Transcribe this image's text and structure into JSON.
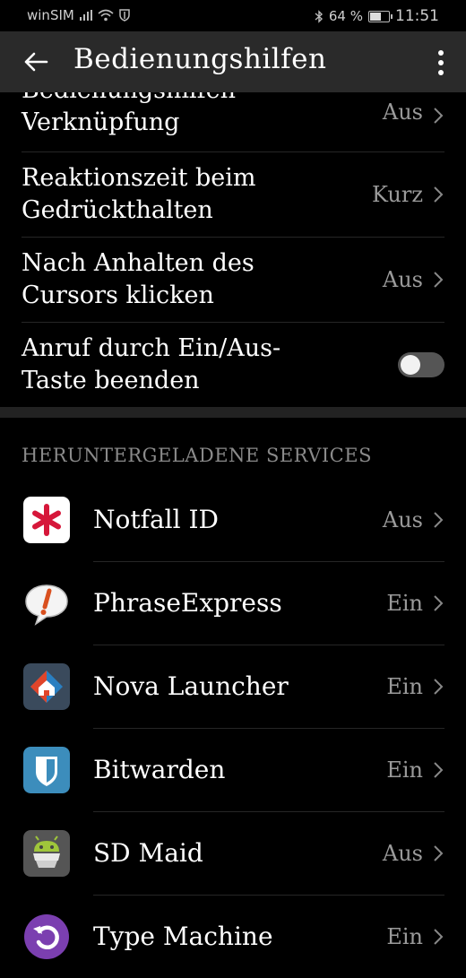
{
  "status_bar": {
    "carrier": "winSIM",
    "battery_percent": "64 %",
    "battery_level": 0.64,
    "time": "11:51"
  },
  "app_bar": {
    "title": "Bedienungshilfen"
  },
  "settings": [
    {
      "label": "Bedienungshilfen-\nVerknüpfung",
      "value": "Aus"
    },
    {
      "label": "Reaktionszeit beim Gedrückthalten",
      "value": "Kurz"
    },
    {
      "label": "Nach Anhalten des Cursors klicken",
      "value": "Aus"
    },
    {
      "label": "Anruf durch Ein/Aus-Taste beenden",
      "toggle_on": false
    }
  ],
  "section_header": "HERUNTERGELADENE SERVICES",
  "services": [
    {
      "name": "Notfall ID",
      "value": "Aus",
      "icon": "emergency-asterisk-icon"
    },
    {
      "name": "PhraseExpress",
      "value": "Ein",
      "icon": "speech-bubble-icon"
    },
    {
      "name": "Nova Launcher",
      "value": "Ein",
      "icon": "nova-launcher-icon"
    },
    {
      "name": "Bitwarden",
      "value": "Ein",
      "icon": "shield-icon"
    },
    {
      "name": "SD Maid",
      "value": "Aus",
      "icon": "android-robot-icon"
    },
    {
      "name": "Type Machine",
      "value": "Ein",
      "icon": "undo-arrow-icon"
    }
  ],
  "colors": {
    "background": "#000000",
    "app_bar": "#2a2a2a",
    "notfall_red": "#d6173a",
    "bitwarden_blue": "#3c8dbc",
    "typemachine_purple": "#7b3fb0"
  }
}
